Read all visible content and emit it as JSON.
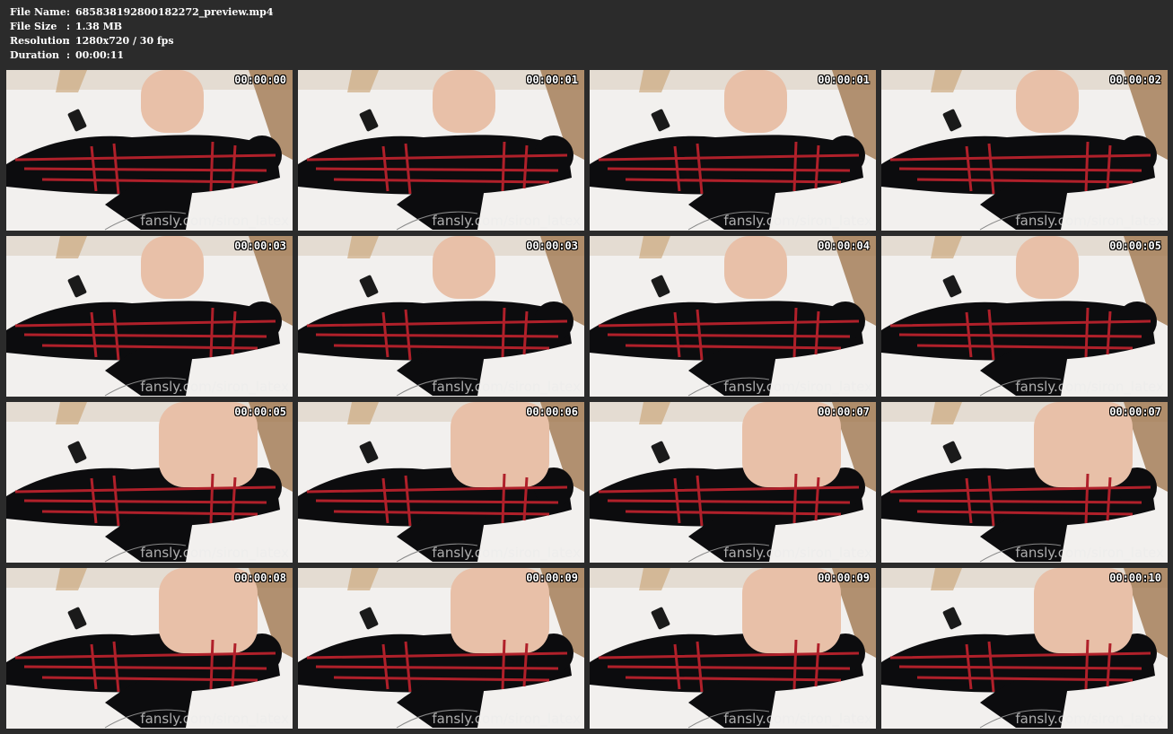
{
  "info": {
    "rows": [
      {
        "label": "File Name",
        "sep": ":",
        "value": "685838192800182272_preview.mp4"
      },
      {
        "label": "File Size",
        "sep": ":",
        "value": "1.38 MB"
      },
      {
        "label": "Resolution",
        "sep": ":",
        "value": "1280x720 / 30 fps"
      },
      {
        "label": "Duration",
        "sep": ":",
        "value": "00:00:11"
      }
    ]
  },
  "thumbnails": [
    {
      "timestamp": "00:00:00",
      "watermark": "fansly.com/siron_latex"
    },
    {
      "timestamp": "00:00:01",
      "watermark": "fansly.com/siron_latex"
    },
    {
      "timestamp": "00:00:01",
      "watermark": "fansly.com/siron_latex"
    },
    {
      "timestamp": "00:00:02",
      "watermark": "fansly.com/siron_latex"
    },
    {
      "timestamp": "00:00:03",
      "watermark": "fansly.com/siron_latex"
    },
    {
      "timestamp": "00:00:03",
      "watermark": "fansly.com/siron_latex"
    },
    {
      "timestamp": "00:00:04",
      "watermark": "fansly.com/siron_latex"
    },
    {
      "timestamp": "00:00:05",
      "watermark": "fansly.com/siron_latex"
    },
    {
      "timestamp": "00:00:05",
      "watermark": "fansly.com/siron_latex"
    },
    {
      "timestamp": "00:00:06",
      "watermark": "fansly.com/siron_latex"
    },
    {
      "timestamp": "00:00:07",
      "watermark": "fansly.com/siron_latex"
    },
    {
      "timestamp": "00:00:07",
      "watermark": "fansly.com/siron_latex"
    },
    {
      "timestamp": "00:00:08",
      "watermark": "fansly.com/siron_latex"
    },
    {
      "timestamp": "00:00:09",
      "watermark": "fansly.com/siron_latex"
    },
    {
      "timestamp": "00:00:09",
      "watermark": "fansly.com/siron_latex"
    },
    {
      "timestamp": "00:00:10",
      "watermark": "fansly.com/siron_latex"
    }
  ],
  "colors": {
    "background": "#2b2b2b",
    "info_text": "#ffffff",
    "sheet": "#f2f0ee",
    "latex": "#0c0c0e",
    "rope": "#b0202a",
    "skin": "#e8c0a8",
    "wood": "#a07850"
  }
}
